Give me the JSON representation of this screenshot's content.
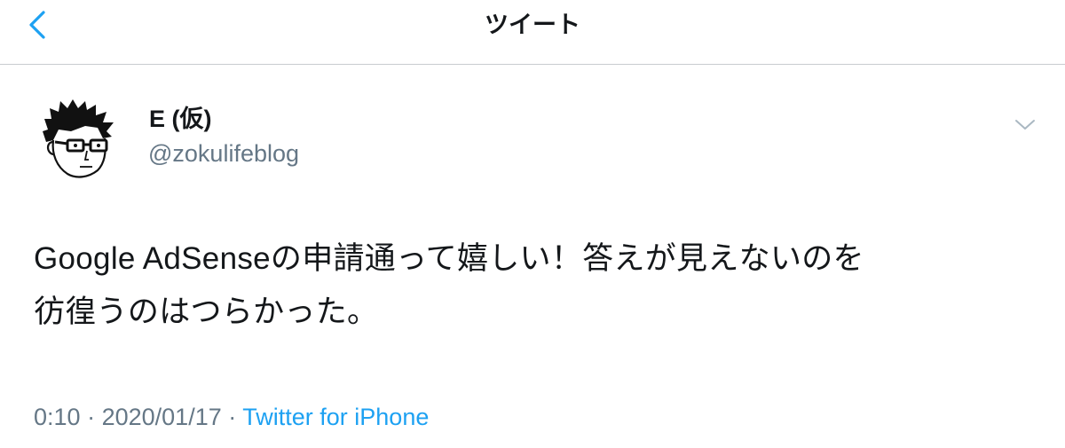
{
  "header": {
    "title": "ツイート",
    "back_icon": "chevron-left-icon"
  },
  "tweet": {
    "author": {
      "display_name": "E (仮)",
      "handle": "@zokulifeblog",
      "avatar_icon": "avatar-illustration"
    },
    "menu_icon": "chevron-down-icon",
    "text_lines": [
      "Google AdSenseの申請通って嬉しい！答えが見えないのを",
      "彷徨うのはつらかった。"
    ],
    "time": "0:10",
    "separator": "·",
    "date": "2020/01/17",
    "source": "Twitter for iPhone"
  },
  "colors": {
    "accent": "#1da1f2",
    "text": "#14171a",
    "secondary": "#657786",
    "divider": "#c8ccd0"
  }
}
